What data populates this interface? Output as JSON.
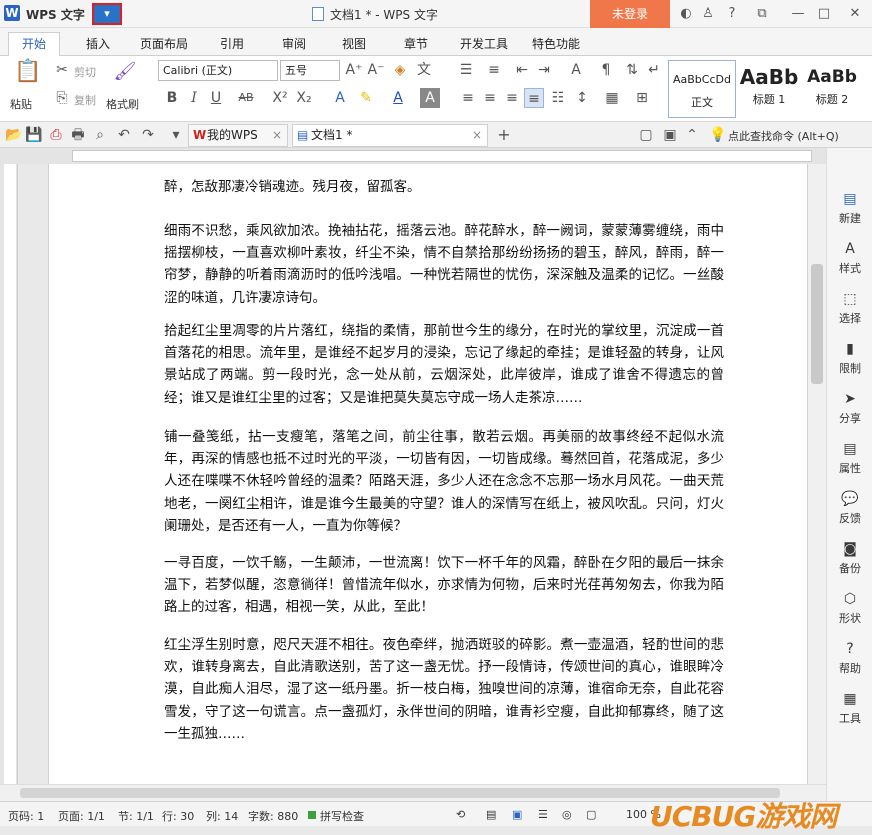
{
  "titlebar": {
    "logo": "W",
    "app_name": "WPS 文字",
    "menu_arrow": "▾",
    "doc_title": "文档1 * - WPS 文字",
    "login": "未登录"
  },
  "tabs": [
    "开始",
    "插入",
    "页面布局",
    "引用",
    "审阅",
    "视图",
    "章节",
    "开发工具",
    "特色功能"
  ],
  "ribbon": {
    "paste": "粘贴",
    "cut": "剪切",
    "copy": "复制",
    "format_painter": "格式刷",
    "font_name": "Calibri (正文)",
    "font_size": "五号",
    "styles": [
      {
        "preview": "AaBbCcDd",
        "name": "正文"
      },
      {
        "preview": "AaBb",
        "name": "标题 1"
      },
      {
        "preview": "AaBb",
        "name": "标题 2"
      }
    ]
  },
  "qabar": {
    "tab_mywps": "我的WPS",
    "tab_doc": "文档1 *",
    "search": "点此查找命令 (Alt+Q)"
  },
  "document": {
    "paragraphs": [
      "醉，怎敌那凄冷销魂迹。残月夜，留孤客。",
      "细雨不识愁，乘风欲加浓。挽袖拈花，摇落云池。醉花醉水，醉一阙词，蒙蒙薄雾缠绕，雨中摇摆柳枝，一直喜欢柳叶素妆，纤尘不染，情不自禁拾那纷纷扬扬的碧玉，醉风，醉雨，醉一帘梦，静静的听着雨滴沥时的低吟浅唱。一种恍若隔世的忧伤，深深触及温柔的记忆。一丝酸涩的味道，几许凄凉诗句。",
      "拾起红尘里凋零的片片落红，绕指的柔情，那前世今生的缘分，在时光的掌纹里，沉淀成一首首落花的相思。流年里，是谁经不起岁月的浸染，忘记了缘起的牵挂；是谁轻盈的转身，让风景站成了两端。剪一段时光，念一处从前，云烟深处，此岸彼岸，谁成了谁舍不得遗忘的曾经；谁又是谁红尘里的过客；又是谁把莫失莫忘守成一场人走茶凉……",
      "铺一叠笺纸，拈一支瘦笔，落笔之间，前尘往事，散若云烟。再美丽的故事终经不起似水流年，再深的情感也抵不过时光的平淡，一切皆有因，一切皆成缘。蓦然回首，花落成泥，多少人还在喋喋不休轻吟曾经的温柔？陌路天涯，多少人还在念念不忘那一场水月风花。一曲天荒地老，一阕红尘相许，谁是谁今生最美的守望？谁人的深情写在纸上，被风吹乱。只问，灯火阑珊处，是否还有一人，一直为你等候？",
      "一寻百度，一饮千觞，一生颠沛，一世流离！饮下一杯千年的风霜，醉卧在夕阳的最后一抹余温下，若梦似醒，恣意徜徉！曾惜流年似水，亦求情为何物，后来时光荏苒匆匆去，你我为陌路上的过客，相遇，相视一笑，从此，至此！",
      "红尘浮生别时意，咫尺天涯不相往。夜色牵绊，抛洒斑驳的碎影。煮一壶温酒，轻酌世间的悲欢，谁转身离去，自此清歌送别，苦了这一盏无忧。抒一段情诗，传颂世间的真心，谁眼眸冷漠，自此痴人泪尽，湿了这一纸丹墨。折一枝白梅，独嗅世间的凉薄，谁宿命无奈，自此花容雪发，守了这一句谎言。点一盏孤灯，永伴世间的阴暗，谁青衫空瘦，自此抑郁寡终，随了这一生孤独……"
    ]
  },
  "right_panel": [
    "新建",
    "样式",
    "选择",
    "限制",
    "分享",
    "属性",
    "反馈",
    "备份",
    "形状",
    "帮助",
    "工具"
  ],
  "status": {
    "page_num": "页码: 1",
    "pages": "页面: 1/1",
    "section": "节: 1/1",
    "row": "行: 30",
    "col": "列: 14",
    "words": "字数: 880",
    "spellcheck": "拼写检查",
    "zoom": "100 %"
  },
  "watermark": "UCBUG游戏网"
}
